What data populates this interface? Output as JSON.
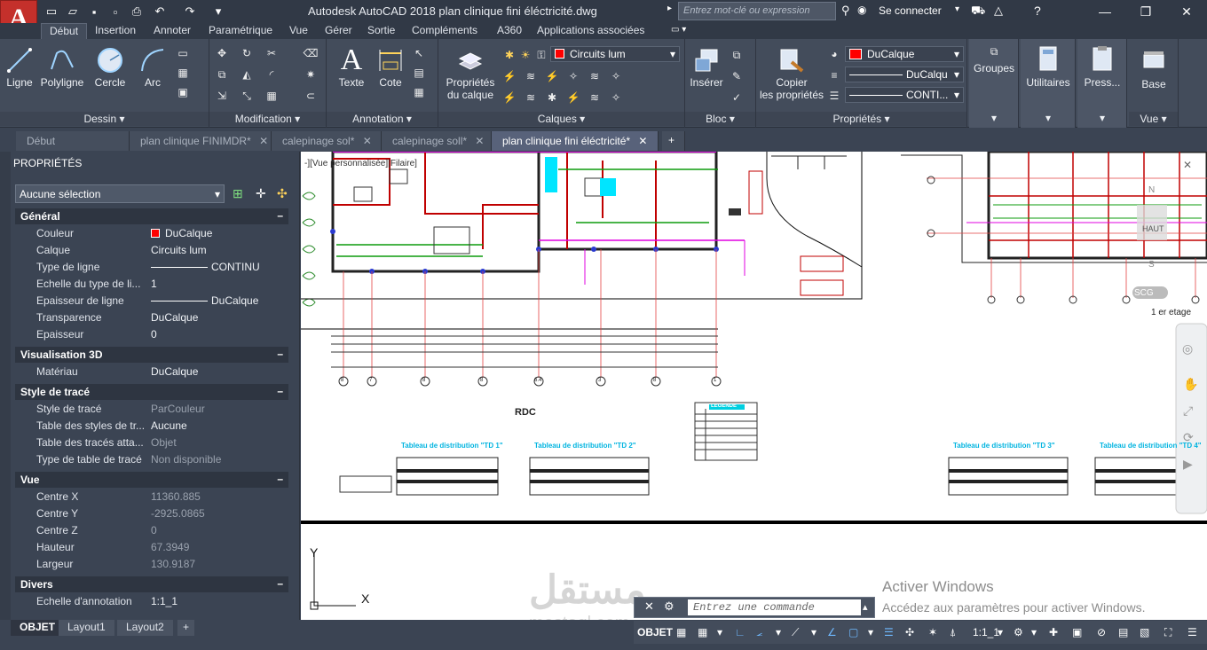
{
  "titlebar": {
    "app_letter": "A",
    "title": "Autodesk AutoCAD 2018    plan clinique fini éléctricité.dwg",
    "search_placeholder": "Entrez mot-clé ou expression",
    "signin": "Se connecter",
    "min_icon": "minimize-icon",
    "max_icon": "restore-icon",
    "close_icon": "close-icon"
  },
  "ribbon_tabs": [
    "Début",
    "Insertion",
    "Annoter",
    "Paramétrique",
    "Vue",
    "Gérer",
    "Sortie",
    "Compléments",
    "A360",
    "Applications associées"
  ],
  "panels": {
    "dessin": {
      "label": "Dessin ▾",
      "tools": [
        "Ligne",
        "Polyligne",
        "Cercle",
        "Arc"
      ]
    },
    "modification": {
      "label": "Modification ▾"
    },
    "annotation": {
      "label": "Annotation ▾",
      "tools": [
        "Texte",
        "Cote"
      ]
    },
    "calques": {
      "label": "Calques ▾",
      "props_btn_1": "Propriétés",
      "props_btn_2": "du calque",
      "layer_value": "Circuits lum"
    },
    "bloc": {
      "label": "Bloc ▾",
      "insert": "Insérer"
    },
    "proprietes": {
      "label": "Propriétés ▾",
      "copy_1": "Copier",
      "copy_2": "les propriétés",
      "color": "DuCalque",
      "lineweight": "DuCalqu",
      "linetype": "CONTI..."
    },
    "groupes": {
      "label": "Groupes"
    },
    "utilitaires": {
      "label": "Utilitaires"
    },
    "presse": {
      "label": "Press..."
    },
    "vue": {
      "label": "Vue ▾",
      "base": "Base"
    }
  },
  "doc_tabs": [
    "Début",
    "plan clinique FINIMDR*",
    "calepinage sol*",
    "calepinage soll*",
    "plan clinique fini éléctricité*"
  ],
  "properties": {
    "title": "PROPRIÉTÉS",
    "selection": "Aucune sélection",
    "sections": [
      {
        "name": "Général",
        "rows": [
          {
            "k": "Couleur",
            "v": "DuCalque"
          },
          {
            "k": "Calque",
            "v": "Circuits lum"
          },
          {
            "k": "Type de ligne",
            "v": "CONTINU"
          },
          {
            "k": "Echelle du type de li...",
            "v": "1"
          },
          {
            "k": "Epaisseur de ligne",
            "v": "DuCalque"
          },
          {
            "k": "Transparence",
            "v": "DuCalque"
          },
          {
            "k": "Epaisseur",
            "v": "0"
          }
        ]
      },
      {
        "name": "Visualisation 3D",
        "rows": [
          {
            "k": "Matériau",
            "v": "DuCalque"
          }
        ]
      },
      {
        "name": "Style de tracé",
        "rows": [
          {
            "k": "Style de tracé",
            "v": "ParCouleur"
          },
          {
            "k": "Table des styles de tr...",
            "v": "Aucune"
          },
          {
            "k": "Table des tracés atta...",
            "v": "Objet"
          },
          {
            "k": "Type de table de tracé",
            "v": "Non disponible"
          }
        ]
      },
      {
        "name": "Vue",
        "rows": [
          {
            "k": "Centre X",
            "v": "11360.885"
          },
          {
            "k": "Centre Y",
            "v": "-2925.0865"
          },
          {
            "k": "Centre Z",
            "v": "0"
          },
          {
            "k": "Hauteur",
            "v": "67.3949"
          },
          {
            "k": "Largeur",
            "v": "130.9187"
          }
        ]
      },
      {
        "name": "Divers",
        "rows": [
          {
            "k": "Echelle d'annotation",
            "v": "1:1_1"
          }
        ]
      }
    ]
  },
  "drawing": {
    "rdc": "RDC",
    "etage": "1 er etage",
    "legend": "LEGENDE",
    "td1": "Tableau de distribution \"TD 1\"",
    "td2": "Tableau de distribution \"TD 2\"",
    "td3": "Tableau de distribution \"TD 3\"",
    "td4": "Tableau de distribution \"TD 4\"",
    "scg": "SCG",
    "axis_y": "Y",
    "axis_x": "X",
    "view_label": "-][Vue personnalisée][Filaire]",
    "compass_n": "N",
    "compass_s": "S",
    "compass_haut": "HAUT",
    "grid_labels": [
      "8",
      "7",
      "8",
      "8",
      "6.4",
      "3",
      "8",
      "1"
    ]
  },
  "bottom": {
    "layout_tabs": [
      "OBJET",
      "Layout1",
      "Layout2"
    ],
    "command_placeholder": "Entrez une commande",
    "objet": "OBJET",
    "scale": "1:1_1",
    "activate_1": "Activer Windows",
    "activate_2": "Accédez aux paramètres pour activer Windows.",
    "watermark": "مستقل",
    "watermark_2": "mostaql.com"
  },
  "colors": {
    "accent": "#c4302b",
    "ribbon": "#434c5b",
    "panel": "#3b4453",
    "layer_red": "#ff0000"
  }
}
